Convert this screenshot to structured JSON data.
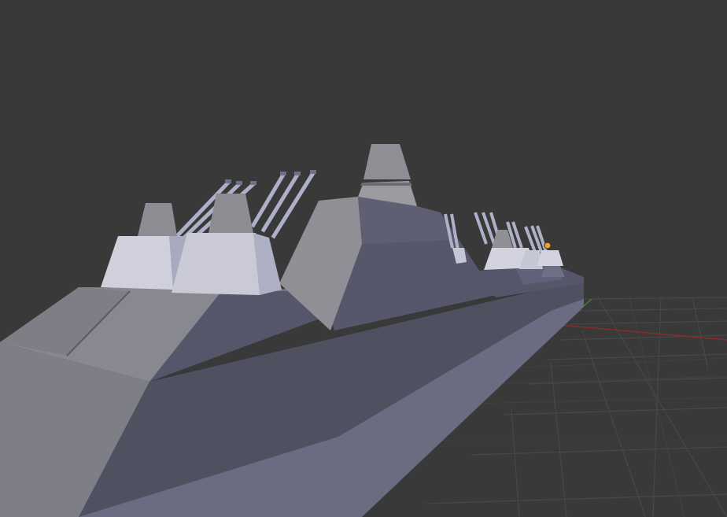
{
  "viewport": {
    "background": "#393939",
    "grid_color": "#4a4a4a",
    "x_axis_color": "#8a2a2a",
    "y_axis_color": "#4f7a3a",
    "origin_icon": "object-origin-icon"
  },
  "model": {
    "hull_colors": {
      "deck_light": "#8a8a8a",
      "hull_dark": "#4f5060",
      "hull_mid": "#5e6075",
      "hull_lower": "#6a6d82",
      "superstructure": "#56576a",
      "turret_light": "#c8c8d6",
      "turret_top": "#8c8c92",
      "barrel": "#aeb0c8"
    }
  }
}
